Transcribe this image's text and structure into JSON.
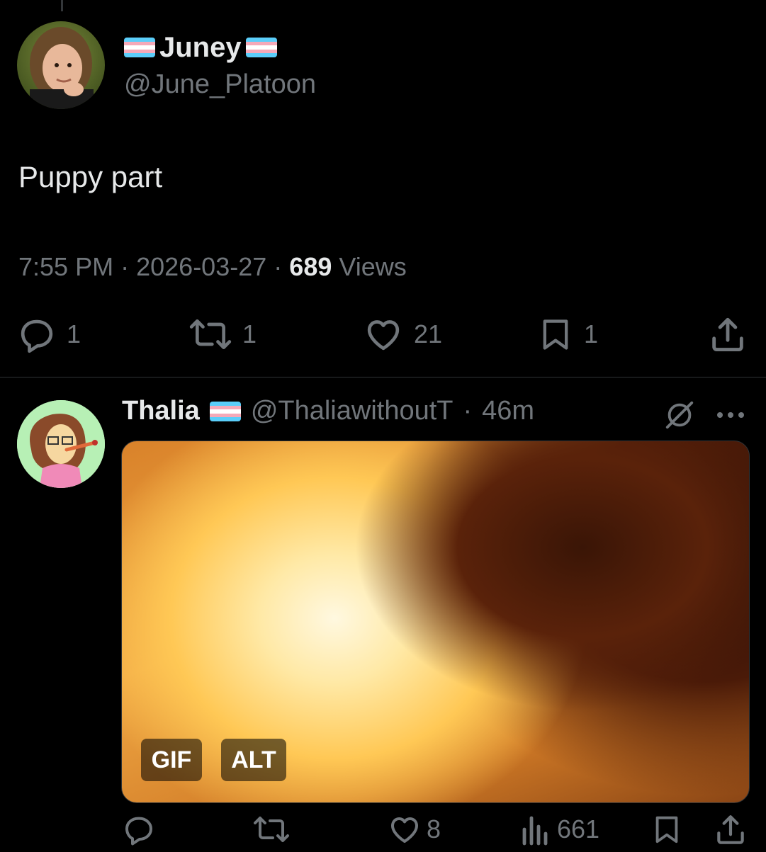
{
  "main_tweet": {
    "display_name": "Juney",
    "handle": "@June_Platoon",
    "text": "Puppy part",
    "time": "7:55 PM",
    "date": "2026-03-27",
    "views_count": "689",
    "views_label": "Views",
    "separator": "·",
    "actions": {
      "replies": "1",
      "retweets": "1",
      "likes": "21",
      "bookmarks": "1"
    }
  },
  "reply_tweet": {
    "display_name": "Thalia",
    "handle": "@ThaliawithoutT",
    "time_ago": "46m",
    "separator": "·",
    "media": {
      "badge_gif": "GIF",
      "badge_alt": "ALT"
    },
    "actions": {
      "likes": "8",
      "views": "661"
    }
  },
  "icons": {
    "reply": "reply-icon",
    "retweet": "retweet-icon",
    "like": "heart-icon",
    "bookmark": "bookmark-icon",
    "share": "share-icon",
    "views": "analytics-icon",
    "grok": "grok-icon",
    "more": "more-icon"
  },
  "colors": {
    "background": "#000000",
    "text_primary": "#e7e9ea",
    "text_secondary": "#71767b",
    "divider": "#2f3336",
    "trans_blue": "#5bcefa",
    "trans_pink": "#f5a9b8"
  }
}
